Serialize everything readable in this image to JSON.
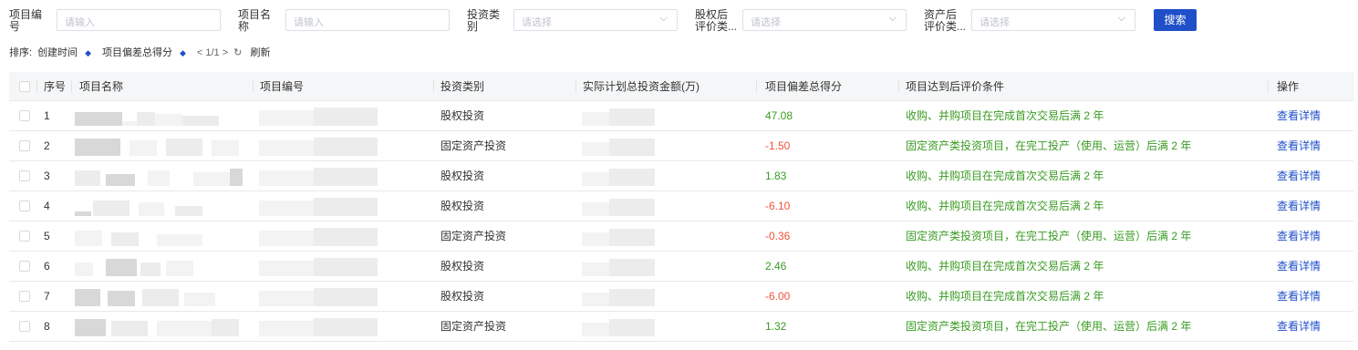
{
  "filters": [
    {
      "label": "项目编\n号",
      "placeholder": "请输入",
      "type": "input"
    },
    {
      "label": "项目名\n称",
      "placeholder": "请输入",
      "type": "input"
    },
    {
      "label": "投资类\n别",
      "placeholder": "请选择",
      "type": "select"
    },
    {
      "label": "股权后\n评价类...",
      "placeholder": "请选择",
      "type": "select"
    },
    {
      "label": "资产后\n评价类...",
      "placeholder": "请选择",
      "type": "select"
    }
  ],
  "search_label": "搜索",
  "sort": {
    "prefix": "排序:",
    "options": [
      "创建时间",
      "项目偏差总得分"
    ],
    "pagination": "< 1/1 >",
    "refresh": "刷新"
  },
  "table": {
    "columns": [
      "序号",
      "项目名称",
      "项目编号",
      "投资类别",
      "实际计划总投资金额(万)",
      "项目偏差总得分",
      "项目达到后评价条件",
      "操作"
    ],
    "rows": [
      {
        "index": "1",
        "category": "股权投资",
        "score": "47.08",
        "score_sign": "pos",
        "condition": "收购、并购项目在完成首次交易后满 2 年",
        "action": "查看详情"
      },
      {
        "index": "2",
        "category": "固定资产投资",
        "score": "-1.50",
        "score_sign": "neg",
        "condition": "固定资产类投资项目，在完工投产（使用、运营）后满 2 年",
        "action": "查看详情"
      },
      {
        "index": "3",
        "category": "股权投资",
        "score": "1.83",
        "score_sign": "pos",
        "condition": "收购、并购项目在完成首次交易后满 2 年",
        "action": "查看详情"
      },
      {
        "index": "4",
        "category": "股权投资",
        "score": "-6.10",
        "score_sign": "neg",
        "condition": "收购、并购项目在完成首次交易后满 2 年",
        "action": "查看详情"
      },
      {
        "index": "5",
        "category": "固定资产投资",
        "score": "-0.36",
        "score_sign": "neg",
        "condition": "固定资产类投资项目，在完工投产（使用、运营）后满 2 年",
        "action": "查看详情"
      },
      {
        "index": "6",
        "category": "股权投资",
        "score": "2.46",
        "score_sign": "pos",
        "condition": "收购、并购项目在完成首次交易后满 2 年",
        "action": "查看详情"
      },
      {
        "index": "7",
        "category": "股权投资",
        "score": "-6.00",
        "score_sign": "neg",
        "condition": "收购、并购项目在完成首次交易后满 2 年",
        "action": "查看详情"
      },
      {
        "index": "8",
        "category": "固定资产投资",
        "score": "1.32",
        "score_sign": "pos",
        "condition": "固定资产类投资项目，在完工投产（使用、运营）后满 2 年",
        "action": "查看详情"
      }
    ]
  },
  "colors": {
    "primary": "#1f4fc9",
    "positive": "#3a9b22",
    "negative": "#f0533c",
    "header_bg": "#f5f6f7"
  }
}
